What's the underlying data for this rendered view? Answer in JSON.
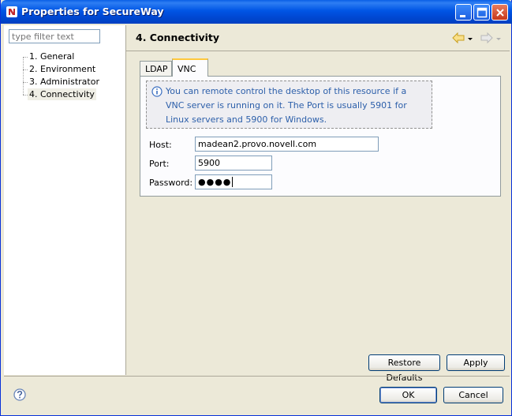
{
  "window": {
    "title": "Properties for SecureWay",
    "icon": "novell-n-icon",
    "controls": [
      "minimize-icon",
      "maximize-icon",
      "close-icon"
    ]
  },
  "sidebar": {
    "filter_placeholder": "type filter text",
    "items": [
      {
        "label": "1. General"
      },
      {
        "label": "2. Environment"
      },
      {
        "label": "3. Administrator"
      },
      {
        "label": "4. Connectivity",
        "selected": true
      }
    ]
  },
  "page": {
    "title": "4. Connectivity",
    "nav_icons": [
      "back-arrow-icon",
      "back-dropdown-icon",
      "forward-arrow-icon",
      "forward-dropdown-icon"
    ],
    "tabs": [
      {
        "label": "LDAP"
      },
      {
        "label": "VNC",
        "active": true
      }
    ],
    "info": "You can remote control the desktop of this resource if a VNC server is running on it. The Port is usually 5901 for Linux servers and 5900 for Windows.",
    "fields": {
      "host_label": "Host:",
      "host_value": "madean2.provo.novell.com",
      "port_label": "Port:",
      "port_value": "5900",
      "password_label": "Password:",
      "password_value": "●●●●"
    },
    "restore_defaults": "Restore Defaults",
    "apply": "Apply"
  },
  "footer": {
    "help_icon": "help-icon",
    "ok": "OK",
    "cancel": "Cancel"
  },
  "colors": {
    "titlebar": "#0055e5",
    "info_text": "#2c5faa",
    "tab_accent": "#ffc83c"
  }
}
